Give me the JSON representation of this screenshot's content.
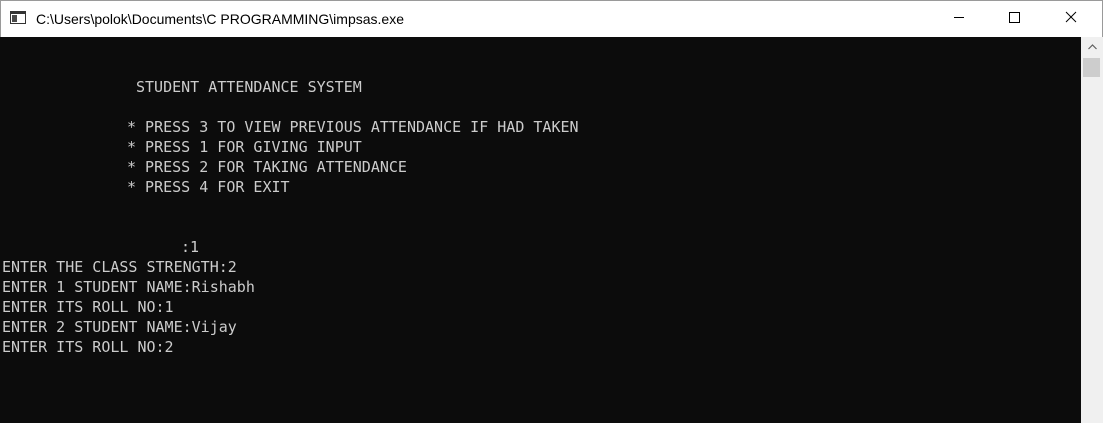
{
  "window": {
    "title": "C:\\Users\\polok\\Documents\\C PROGRAMMING\\impsas.exe",
    "icon": "console-window-icon"
  },
  "controls": {
    "minimize_icon": "minimize-icon",
    "maximize_icon": "maximize-icon",
    "close_icon": "close-icon"
  },
  "console": {
    "heading": "STUDENT ATTENDANCE SYSTEM",
    "menu": [
      "* PRESS 3 TO VIEW PREVIOUS ATTENDANCE IF HAD TAKEN",
      "* PRESS 1 FOR GIVING INPUT",
      "* PRESS 2 FOR TAKING ATTENDANCE",
      "* PRESS 4 FOR EXIT"
    ],
    "prompt": ":1",
    "output": [
      "ENTER THE CLASS STRENGTH:2",
      "ENTER 1 STUDENT NAME:Rishabh",
      "ENTER ITS ROLL NO:1",
      "ENTER 2 STUDENT NAME:Vijay",
      "ENTER ITS ROLL NO:2"
    ]
  },
  "colors": {
    "console_background": "#0c0c0c",
    "console_text": "#cccccc",
    "titlebar_background": "#ffffff"
  }
}
